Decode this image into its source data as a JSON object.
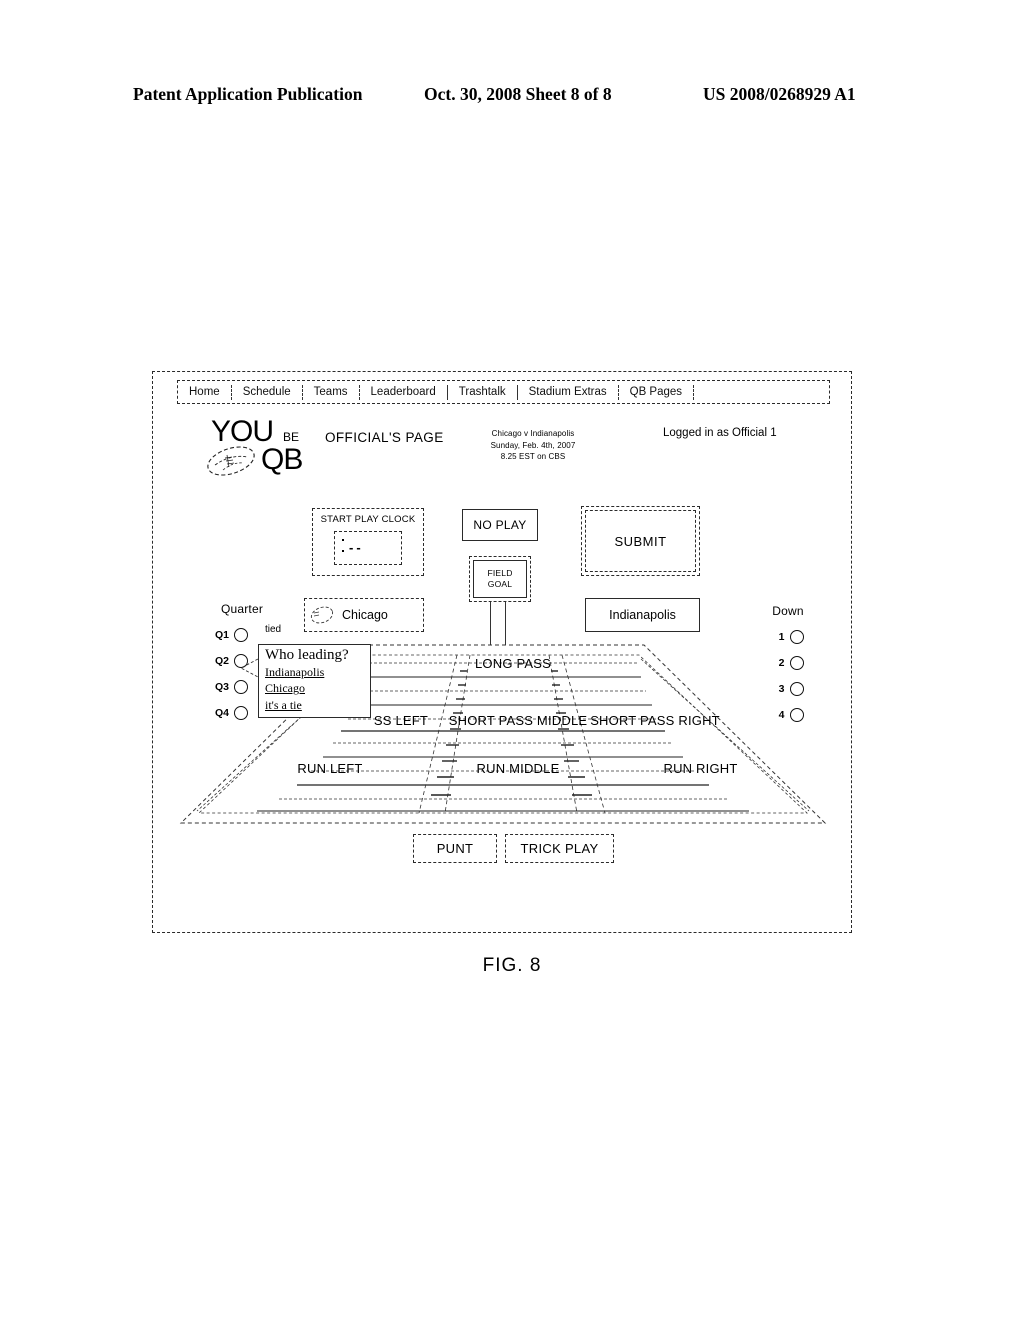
{
  "patent_header": {
    "publication": "Patent Application Publication",
    "date_sheet": "Oct. 30, 2008  Sheet 8 of 8",
    "number": "US 2008/0268929 A1"
  },
  "figure_caption": "FIG. 8",
  "nav": {
    "items": [
      {
        "label": "Home"
      },
      {
        "label": "Schedule"
      },
      {
        "label": "Teams"
      },
      {
        "label": "Leaderboard"
      },
      {
        "label": "Trashtalk"
      },
      {
        "label": "Stadium Extras"
      },
      {
        "label": "QB Pages"
      }
    ]
  },
  "brand": {
    "you": "YOU",
    "be": "BE",
    "qb": "QB",
    "icon": "football-icon"
  },
  "header": {
    "page_title": "OFFICIAL'S PAGE",
    "game_matchup": "Chicago v Indianapolis",
    "game_date": "Sunday, Feb. 4th, 2007",
    "game_broadcast": "8.25 EST on CBS",
    "logged_in": "Logged in as Official 1"
  },
  "controls": {
    "play_clock_label": "START PLAY CLOCK",
    "clock_value": "--",
    "no_play_label": "NO PLAY",
    "field_goal_line1": "FIELD",
    "field_goal_line2": "GOAL",
    "submit_label": "SUBMIT"
  },
  "teams": {
    "home": "Chicago",
    "home_icon": "team-logo-icon",
    "away": "Indianapolis"
  },
  "quarter": {
    "title": "Quarter",
    "options": [
      {
        "label": "Q1",
        "selected": false
      },
      {
        "label": "Q2",
        "selected": false
      },
      {
        "label": "Q3",
        "selected": false
      },
      {
        "label": "Q4",
        "selected": false
      }
    ],
    "status": "tied"
  },
  "down": {
    "title": "Down",
    "options": [
      {
        "label": "1",
        "selected": false
      },
      {
        "label": "2",
        "selected": false
      },
      {
        "label": "3",
        "selected": false
      },
      {
        "label": "4",
        "selected": false
      }
    ]
  },
  "who_leading": {
    "title": "Who leading?",
    "options": [
      {
        "label": "Indianapolis"
      },
      {
        "label": "Chicago"
      },
      {
        "label": "it's a tie"
      }
    ]
  },
  "field_plays": {
    "long_pass": "LONG PASS",
    "short_pass_left": "SS LEFT",
    "short_pass_middle": "SHORT PASS MIDDLE",
    "short_pass_right": "SHORT PASS RIGHT",
    "run_left": "RUN LEFT",
    "run_middle": "RUN MIDDLE",
    "run_right": "RUN RIGHT"
  },
  "bottom_plays": {
    "punt": "PUNT",
    "trick_play": "TRICK PLAY"
  }
}
